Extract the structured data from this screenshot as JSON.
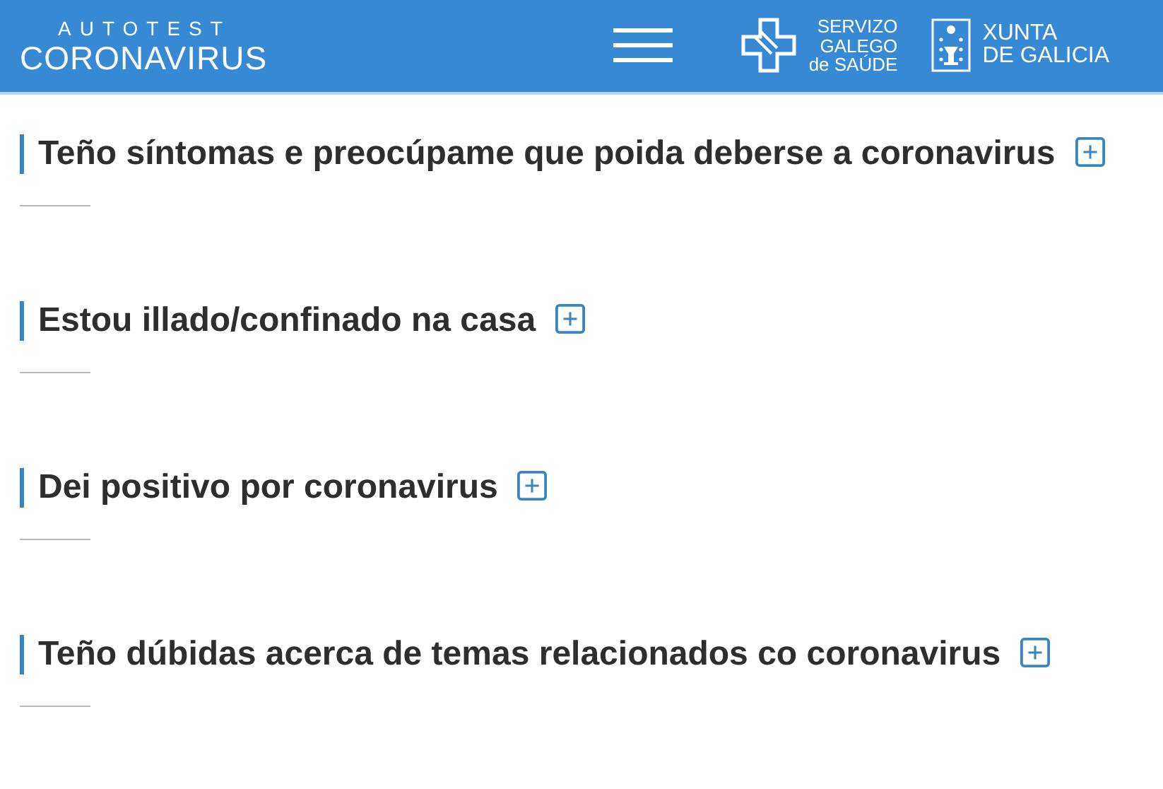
{
  "header": {
    "logo_small": "AUTOTEST",
    "logo_large": "CORONAVIRUS",
    "brand_1": [
      "SERVIZO",
      "GALEGO",
      "de SAÚDE"
    ],
    "brand_2": [
      "XUNTA",
      "DE GALICIA"
    ]
  },
  "sections": [
    {
      "title": "Teño síntomas e preocúpame que poida deberse a coronavirus",
      "expanded": false
    },
    {
      "title": "Estou illado/confinado na casa",
      "expanded": false
    },
    {
      "title": "Dei positivo por coronavirus",
      "expanded": false
    },
    {
      "title": "Teño dúbidas acerca de temas relacionados co coronavirus",
      "expanded": false
    }
  ]
}
